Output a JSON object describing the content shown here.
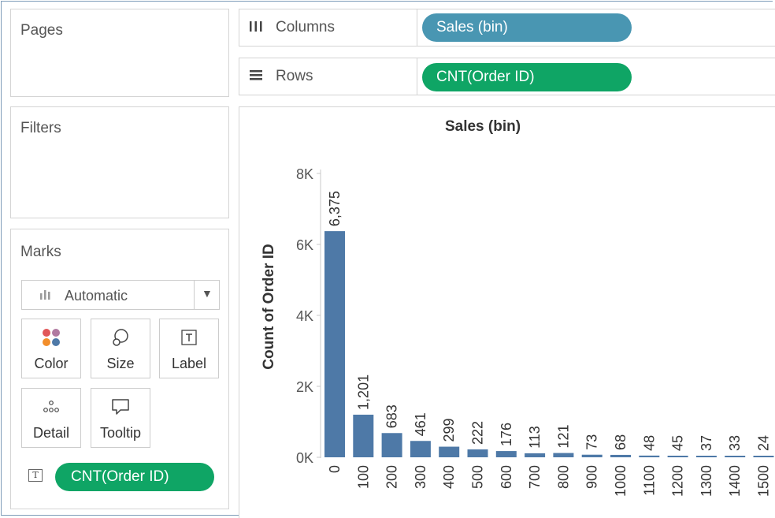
{
  "cards": {
    "pages_title": "Pages",
    "filters_title": "Filters",
    "marks_title": "Marks"
  },
  "shelves": {
    "columns_label": "Columns",
    "columns_icon": "columns-icon",
    "columns_pill": "Sales (bin)",
    "rows_label": "Rows",
    "rows_icon": "rows-icon",
    "rows_pill": "CNT(Order ID)"
  },
  "marks": {
    "type_label": "Automatic",
    "buttons": {
      "color": "Color",
      "size": "Size",
      "label": "Label",
      "detail": "Detail",
      "tooltip": "Tooltip"
    },
    "field_pill": "CNT(Order ID)"
  },
  "colors": {
    "columns_pill": "#4996b2",
    "rows_pill": "#0fa565",
    "bar": "#4e79a7"
  },
  "chart_data": {
    "type": "bar",
    "title": "Sales (bin)",
    "ylabel": "Count of Order ID",
    "xlabel": "",
    "categories": [
      "0",
      "100",
      "200",
      "300",
      "400",
      "500",
      "600",
      "700",
      "800",
      "900",
      "1000",
      "1100",
      "1200",
      "1300",
      "1400",
      "1500"
    ],
    "values": [
      6375,
      1201,
      683,
      461,
      299,
      222,
      176,
      113,
      121,
      73,
      68,
      48,
      45,
      37,
      33,
      24
    ],
    "data_labels": [
      "6,375",
      "1,201",
      "683",
      "461",
      "299",
      "222",
      "176",
      "113",
      "121",
      "73",
      "68",
      "48",
      "45",
      "37",
      "33",
      "24"
    ],
    "yticks": [
      0,
      2000,
      4000,
      6000,
      8000
    ],
    "ytick_labels": [
      "0K",
      "2K",
      "4K",
      "6K",
      "8K"
    ],
    "ylim": [
      0,
      8000
    ],
    "grid": false
  }
}
